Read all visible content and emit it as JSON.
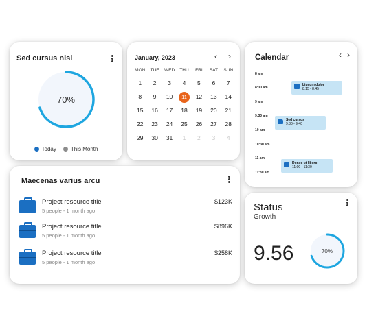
{
  "colors": {
    "accent": "#1ea6e0",
    "primary": "#1b6fc2",
    "muted_dot": "#8c8c8c",
    "highlight": "#e8641b",
    "ring_fill": "#f2f6fc",
    "event_bg": "#c6e4f5"
  },
  "gauge_card": {
    "title": "Sed cursus nisi",
    "percent_label": "70%",
    "progress": 0.7,
    "legend": [
      {
        "label": "Today",
        "color": "#1b6fc2"
      },
      {
        "label": "This Month",
        "color": "#8c8c8c"
      }
    ]
  },
  "month_calendar": {
    "month_label": "January, 2023",
    "prev_icon": "chevron-left-icon",
    "next_icon": "chevron-right-icon",
    "weekdays": [
      "MON",
      "TUE",
      "WED",
      "THU",
      "FRI",
      "SAT",
      "SUN"
    ],
    "days": [
      "1",
      "2",
      "3",
      "4",
      "5",
      "6",
      "7",
      "8",
      "9",
      "10",
      "11",
      "12",
      "13",
      "14",
      "15",
      "16",
      "17",
      "18",
      "19",
      "20",
      "21",
      "22",
      "23",
      "24",
      "25",
      "26",
      "27",
      "28",
      "29",
      "30",
      "31",
      "1",
      "2",
      "3",
      "4"
    ],
    "selected_day": "11"
  },
  "schedule_card": {
    "title": "Calendar",
    "times": [
      "8 am",
      "8:30 am",
      "9 am",
      "9:30 am",
      "10 am",
      "10:30 am",
      "11 am",
      "11:30 am"
    ],
    "events": [
      {
        "title": "Lipsum dolor",
        "time": "8:15 - 8:45",
        "icon": "file-icon"
      },
      {
        "title": "Sed cursus",
        "time": "9:30 - 9:40",
        "icon": "person-icon"
      },
      {
        "title": "Donec ut libero",
        "time": "11:00 - 11:30",
        "icon": "file-icon"
      }
    ]
  },
  "list_card": {
    "title": "Maecenas varius arcu",
    "items": [
      {
        "title": "Project resource title",
        "subtitle": "5 people - 1 month ago",
        "amount": "$123K",
        "icon": "briefcase-icon"
      },
      {
        "title": "Project resource title",
        "subtitle": "5 people - 1 month ago",
        "amount": "$896K",
        "icon": "briefcase-icon"
      },
      {
        "title": "Project resource title",
        "subtitle": "5 people - 1 month ago",
        "amount": "$258K",
        "icon": "briefcase-icon"
      }
    ]
  },
  "status_card": {
    "title": "Status",
    "subtitle": "Growth",
    "value": "9.56",
    "percent_label": "70%",
    "progress": 0.7
  }
}
